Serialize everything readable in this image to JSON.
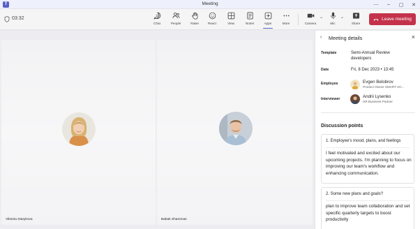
{
  "window": {
    "title": "Meeting",
    "app_icon": "teams-icon"
  },
  "toolbar": {
    "timer": "03:32",
    "buttons": [
      {
        "label": "Chat",
        "icon": "chat-icon"
      },
      {
        "label": "People",
        "icon": "people-icon"
      },
      {
        "label": "Raise",
        "icon": "raise-hand-icon"
      },
      {
        "label": "React",
        "icon": "react-icon"
      },
      {
        "label": "View",
        "icon": "view-icon"
      },
      {
        "label": "Notes",
        "icon": "notes-icon"
      },
      {
        "label": "Apps",
        "icon": "apps-icon"
      },
      {
        "label": "More",
        "icon": "more-icon"
      },
      {
        "label": "Camera",
        "icon": "camera-icon"
      },
      {
        "label": "Mic",
        "icon": "mic-icon"
      },
      {
        "label": "Share",
        "icon": "share-icon"
      }
    ],
    "leave_label": "Leave meeting",
    "leave_color": "#c4314b",
    "accent": "#5b5fc7"
  },
  "participants": [
    {
      "name": "Viktoria Starykova"
    },
    {
      "name": "Babak Shammas"
    }
  ],
  "panel": {
    "title": "Meeting details",
    "template_label": "Template",
    "template_value": "Semi-Annual Review developers",
    "template_line1": "Semi-Annual Review",
    "template_line2": "developers",
    "date_label": "Date",
    "date_value": "Fri, 8 Dec 2023 • 13:45",
    "employee_label": "Employee",
    "employee_name": "Evgen Belobrov",
    "employee_role": "Product Owner SMART HC...",
    "interviewer_label": "Interviewer",
    "interviewer_name": "Andrii Lysenko",
    "interviewer_role": "HR Business Partner",
    "discussion_title": "Discussion points",
    "points": [
      {
        "question": "1.  Employee's mood, plans, and feelings",
        "answer": "I feel motivated and excited about our upcoming projects. I'm planning to focus on improving our team's workflow and enhancing communication."
      },
      {
        "question": "2.  Some new plans and goals?",
        "answer": "plan to improve team collaboration and set specific quarterly targets to boost productivity"
      }
    ]
  }
}
